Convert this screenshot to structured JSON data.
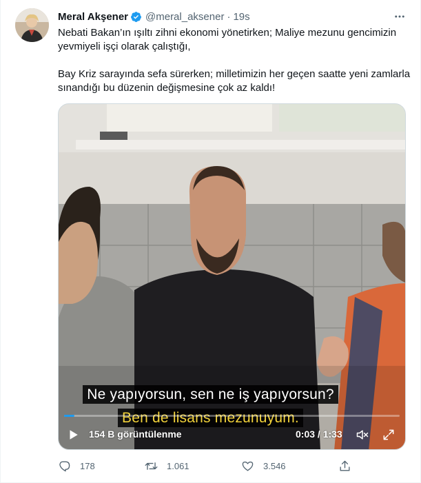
{
  "author": {
    "display_name": "Meral Akşener",
    "handle": "@meral_aksener",
    "separator": "·",
    "time": "19s",
    "verified": true,
    "verified_color": "#1d9bf0"
  },
  "tweet": {
    "paragraphs": [
      "Nebati Bakan’ın ışıltı zihni ekonomi yönetirken; Maliye mezunu gencimizin\nyevmiyeli işçi olarak çalıştığı,",
      "Bay Kriz sarayında sefa sürerken; milletimizin her geçen saatte yeni zamlarla\nsınandığı bu düzenin değişmesine çok az kaldı!"
    ]
  },
  "video": {
    "subtitle_line_1": "Ne yapıyorsun, sen ne iş yapıyorsun?",
    "subtitle_line_2": "Ben de lisans mezunuyum.",
    "views": "154 B görüntülenme",
    "timer": "0:03 / 1:33",
    "progress": 0.03,
    "progress_color": "#1d9bf0",
    "subtitle_2_color": "#f2d23a"
  },
  "actions": {
    "reply_count": "178",
    "retweet_count": "1.061",
    "like_count": "3.546"
  },
  "icons": {
    "more": "more-icon",
    "reply": "reply-icon",
    "retweet": "retweet-icon",
    "like": "heart-icon",
    "share": "share-icon",
    "play": "play-icon",
    "mute": "mute-icon",
    "fullscreen": "fullscreen-icon",
    "verified": "verified-badge-icon"
  }
}
